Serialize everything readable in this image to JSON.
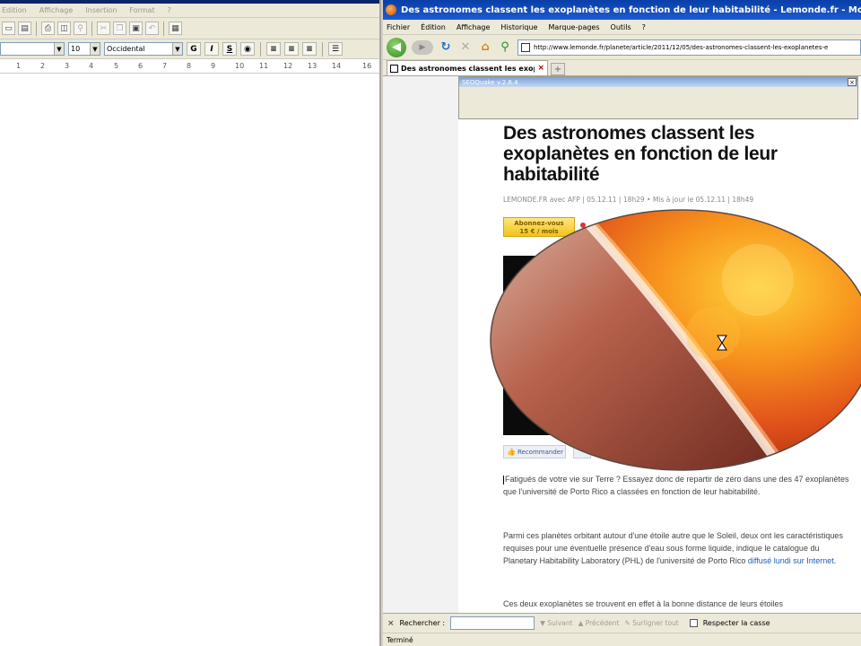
{
  "editor": {
    "menu": [
      "Edition",
      "Affichage",
      "Insertion",
      "Format",
      "?"
    ],
    "font_size": "10",
    "encoding": "Occidental",
    "format_buttons": [
      "G",
      "I",
      "S"
    ],
    "ruler_ticks": [
      "1",
      "2",
      "3",
      "4",
      "5",
      "6",
      "7",
      "8",
      "9",
      "10",
      "11",
      "12",
      "13",
      "14",
      "16"
    ]
  },
  "browser": {
    "title": "Des astronomes classent les exoplanètes en fonction de leur habitabilité - Lemonde.fr - Mozilla Firefox",
    "menu": [
      "Fichier",
      "Édition",
      "Affichage",
      "Historique",
      "Marque-pages",
      "Outils",
      "?"
    ],
    "url": "http://www.lemonde.fr/planete/article/2011/12/05/des-astronomes-classent-les-exoplanetes-e",
    "tab_label": "Des astronomes classent les exopla...",
    "new_tab": "+",
    "tab_close": "×",
    "seoquake_label": "SEOQuake v.2.6.4",
    "seoquake_close": "×",
    "findbar": {
      "close": "×",
      "label": "Rechercher :",
      "next": "Suivant",
      "prev": "Précédent",
      "highlight": "Surligner tout",
      "match_case": "Respecter la casse"
    },
    "status": "Terminé"
  },
  "article": {
    "title": "Des astronomes classent les exoplanètes en fonction de leur habitabilité",
    "meta": "LEMONDE.FR avec AFP | 05.12.11 | 18h29  •  Mis à jour le 05.12.11 | 18h49",
    "subscribe_line1": "Abonnez-vous",
    "subscribe_line2": "15 € / mois",
    "recommend": "Recommander",
    "para1": "Fatigués de votre vie sur Terre ? Essayez donc de repartir de zéro dans une des 47 exoplanètes que l'université de Porto Rico a classées en fonction de leur habitabilité.",
    "para2_a": "Parmi ces planètes orbitant autour d'une étoile autre que le Soleil, deux ont les caractéristiques requises pour une éventuelle présence d'eau sous forme liquide, indique le catalogue du Planetary Habitability Laboratory (PHL) de l'université de Porto Rico ",
    "para2_link": "diffusé lundi sur Internet",
    "para2_end": ".",
    "para3": "Ces deux exoplanètes se trouvent en effet à la bonne distance de leurs étoiles"
  },
  "icons": {
    "back": "◀",
    "forward": "▶",
    "reload": "↻",
    "stop": "✕",
    "home": "⌂",
    "search": "⚲",
    "like": "👍"
  }
}
